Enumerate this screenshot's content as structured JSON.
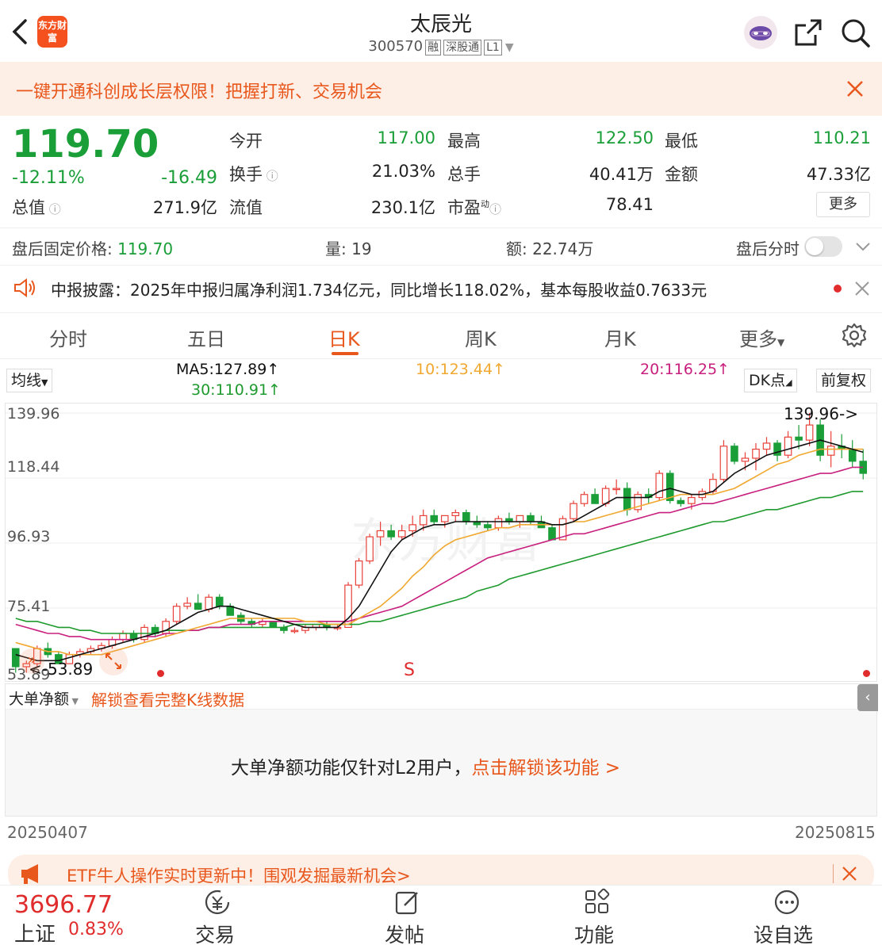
{
  "header": {
    "title": "太辰光",
    "code": "300570",
    "tags": [
      "融",
      "深股通",
      "L1"
    ],
    "logo_text": "东方财富"
  },
  "banner": {
    "text": "一键开通科创成长层权限！把握打新、交易机会"
  },
  "quote": {
    "price": "119.70",
    "change_pct": "-12.11%",
    "change": "-16.49",
    "fields": {
      "open_label": "今开",
      "open": "117.00",
      "high_label": "最高",
      "high": "122.50",
      "low_label": "最低",
      "low": "110.21",
      "turnover_label": "换手",
      "turnover": "21.03%",
      "volume_label": "总手",
      "volume": "40.41万",
      "amount_label": "金额",
      "amount": "47.33亿",
      "mktcap_label": "总值",
      "mktcap": "271.9亿",
      "float_label": "流值",
      "float": "230.1亿",
      "pe_label": "市盈",
      "pe_sup": "动",
      "pe": "78.41"
    },
    "more_label": "更多"
  },
  "after_hours": {
    "price_label": "盘后固定价格:",
    "price": "119.70",
    "vol_label": "量:",
    "vol": "19",
    "amt_label": "额:",
    "amt": "22.74万",
    "timeshare_label": "盘后分时"
  },
  "news": {
    "text": "中报披露：2025年中报归属净利润1.734亿元，同比增长118.02%，基本每股收益0.7633元"
  },
  "tabs": [
    "分时",
    "五日",
    "日K",
    "周K",
    "月K",
    "更多"
  ],
  "ma": {
    "selector": "均线",
    "ma5": "MA5:127.89↑",
    "ma10": "10:123.44↑",
    "ma20": "20:116.25↑",
    "ma30": "30:110.91↑",
    "dk": "DK点",
    "adjust": "前复权"
  },
  "chart_data": {
    "type": "candlestick",
    "y_ticks": [
      "139.96",
      "118.44",
      "96.93",
      "75.41",
      "53.89"
    ],
    "ylim": [
      53.89,
      139.96
    ],
    "max_label": "139.96->",
    "min_label": "<-53.89",
    "signal": "S",
    "watermark": "东方财富",
    "candles": [
      [
        62,
        62,
        54,
        56
      ],
      [
        56,
        58,
        54,
        57
      ],
      [
        57,
        63,
        56,
        62
      ],
      [
        62,
        64,
        59,
        60
      ],
      [
        60,
        61,
        57,
        57
      ],
      [
        57,
        61,
        57,
        60
      ],
      [
        60,
        62,
        59,
        61
      ],
      [
        61,
        63,
        60,
        62
      ],
      [
        62,
        64,
        61,
        63
      ],
      [
        63,
        66,
        62,
        65
      ],
      [
        65,
        68,
        64,
        67
      ],
      [
        67,
        68,
        64,
        65
      ],
      [
        65,
        70,
        64,
        69
      ],
      [
        69,
        70,
        66,
        67
      ],
      [
        67,
        72,
        66,
        71
      ],
      [
        71,
        77,
        70,
        76
      ],
      [
        76,
        79,
        75,
        77
      ],
      [
        77,
        80,
        75,
        75
      ],
      [
        75,
        80,
        74,
        79
      ],
      [
        79,
        80,
        75,
        76
      ],
      [
        76,
        77,
        73,
        73
      ],
      [
        73,
        74,
        70,
        71
      ],
      [
        71,
        72,
        69,
        70
      ],
      [
        70,
        72,
        69,
        71
      ],
      [
        71,
        71,
        69,
        69
      ],
      [
        69,
        70,
        67,
        68
      ],
      [
        68,
        69,
        67,
        68
      ],
      [
        68,
        70,
        67,
        69
      ],
      [
        69,
        70,
        68,
        70
      ],
      [
        70,
        71,
        68,
        69
      ],
      [
        69,
        70,
        68,
        69
      ],
      [
        69,
        84,
        69,
        83
      ],
      [
        83,
        92,
        82,
        91
      ],
      [
        91,
        100,
        90,
        99
      ],
      [
        99,
        104,
        96,
        101
      ],
      [
        101,
        103,
        98,
        99
      ],
      [
        99,
        103,
        98,
        101
      ],
      [
        101,
        106,
        99,
        103
      ],
      [
        103,
        108,
        101,
        106
      ],
      [
        106,
        108,
        103,
        104
      ],
      [
        104,
        106,
        102,
        106
      ],
      [
        106,
        108,
        104,
        107
      ],
      [
        107,
        108,
        103,
        104
      ],
      [
        104,
        106,
        102,
        103
      ],
      [
        103,
        104,
        101,
        102
      ],
      [
        102,
        106,
        101,
        105
      ],
      [
        105,
        107,
        103,
        104
      ],
      [
        104,
        106,
        102,
        106
      ],
      [
        106,
        107,
        103,
        104
      ],
      [
        104,
        106,
        102,
        102
      ],
      [
        102,
        103,
        98,
        98
      ],
      [
        98,
        106,
        98,
        105
      ],
      [
        105,
        111,
        104,
        110
      ],
      [
        110,
        114,
        109,
        113
      ],
      [
        113,
        115,
        110,
        110
      ],
      [
        110,
        116,
        109,
        115
      ],
      [
        115,
        118,
        113,
        115
      ],
      [
        115,
        117,
        106,
        108
      ],
      [
        108,
        114,
        107,
        113
      ],
      [
        113,
        115,
        110,
        112
      ],
      [
        112,
        121,
        111,
        120
      ],
      [
        120,
        121,
        110,
        111
      ],
      [
        111,
        112,
        109,
        110
      ],
      [
        110,
        113,
        108,
        112
      ],
      [
        112,
        115,
        111,
        114
      ],
      [
        114,
        120,
        113,
        118
      ],
      [
        118,
        131,
        117,
        129
      ],
      [
        129,
        130,
        123,
        124
      ],
      [
        124,
        127,
        121,
        125
      ],
      [
        125,
        130,
        121,
        128
      ],
      [
        128,
        132,
        126,
        130
      ],
      [
        130,
        131,
        124,
        126
      ],
      [
        126,
        134,
        125,
        132
      ],
      [
        132,
        136,
        128,
        131
      ],
      [
        131,
        140,
        129,
        136
      ],
      [
        136,
        138,
        124,
        126
      ],
      [
        126,
        134,
        122,
        129
      ],
      [
        129,
        133,
        125,
        128
      ],
      [
        128,
        131,
        122,
        124
      ],
      [
        124,
        128,
        118,
        120
      ]
    ],
    "ma5": [
      60,
      59,
      58,
      58,
      58,
      59,
      60,
      61,
      62,
      63,
      64,
      65,
      66,
      67,
      68,
      70,
      72,
      74,
      75,
      76,
      76,
      75,
      74,
      73,
      72,
      71,
      70,
      69,
      69,
      69,
      69,
      72,
      76,
      82,
      88,
      94,
      98,
      100,
      102,
      103,
      103,
      104,
      104,
      104,
      104,
      104,
      104,
      104,
      104,
      104,
      103,
      103,
      104,
      106,
      108,
      110,
      112,
      112,
      112,
      112,
      114,
      115,
      114,
      113,
      113,
      114,
      117,
      120,
      122,
      124,
      126,
      127,
      128,
      129,
      130,
      131,
      130,
      129,
      128,
      127
    ],
    "ma10": [
      64,
      63,
      62,
      61,
      61,
      60,
      60,
      60,
      60,
      61,
      62,
      63,
      64,
      65,
      66,
      67,
      68,
      69,
      70,
      71,
      72,
      72,
      72,
      72,
      72,
      72,
      72,
      71,
      71,
      70,
      70,
      70,
      72,
      74,
      76,
      79,
      82,
      86,
      89,
      93,
      96,
      98,
      99,
      100,
      101,
      102,
      102,
      103,
      103,
      103,
      103,
      103,
      104,
      104,
      105,
      106,
      107,
      108,
      109,
      110,
      111,
      112,
      113,
      113,
      113,
      113,
      114,
      115,
      117,
      119,
      121,
      123,
      124,
      126,
      127,
      128,
      128,
      128,
      128,
      128
    ],
    "ma20": [
      70,
      69,
      68,
      67,
      67,
      66,
      66,
      65,
      65,
      65,
      65,
      65,
      66,
      66,
      67,
      67,
      68,
      68,
      69,
      69,
      70,
      70,
      70,
      71,
      71,
      71,
      71,
      71,
      71,
      71,
      71,
      71,
      72,
      73,
      74,
      75,
      76,
      78,
      80,
      82,
      84,
      86,
      88,
      90,
      92,
      93,
      94,
      95,
      96,
      97,
      98,
      99,
      100,
      100,
      101,
      102,
      103,
      104,
      105,
      106,
      107,
      107,
      108,
      109,
      110,
      110,
      111,
      112,
      113,
      114,
      115,
      116,
      117,
      118,
      119,
      120,
      120,
      121,
      122,
      122
    ],
    "ma30": [
      72,
      71,
      71,
      70,
      69,
      69,
      68,
      68,
      67,
      67,
      67,
      67,
      67,
      67,
      68,
      68,
      68,
      68,
      69,
      69,
      69,
      69,
      69,
      69,
      69,
      69,
      70,
      70,
      70,
      70,
      70,
      70,
      70,
      71,
      71,
      72,
      73,
      74,
      75,
      76,
      77,
      78,
      79,
      81,
      82,
      83,
      85,
      86,
      87,
      88,
      89,
      90,
      91,
      92,
      93,
      94,
      95,
      96,
      97,
      98,
      99,
      100,
      101,
      102,
      103,
      104,
      104,
      105,
      106,
      107,
      108,
      108,
      109,
      110,
      111,
      112,
      112,
      113,
      114,
      114
    ]
  },
  "lower": {
    "selector": "大单净额",
    "unlock_link": "解锁查看完整K线数据",
    "message": "大单净额功能仅针对L2用户，",
    "message_link": "点击解锁该功能 >"
  },
  "dates": {
    "start": "20250407",
    "end": "20250815"
  },
  "etf": {
    "text": "ETF牛人操作实时更新中！围观发掘最新机会>"
  },
  "index": {
    "value": "3696.77",
    "name": "上证",
    "pct": "0.83%"
  },
  "nav": [
    "交易",
    "发帖",
    "功能",
    "设自选"
  ],
  "colors": {
    "up": "#e8413a",
    "down": "#1a9e38",
    "accent": "#e8571c",
    "ma5": "#111111",
    "ma10": "#f0a830",
    "ma20": "#c8207e",
    "ma30": "#1f9a2e"
  }
}
